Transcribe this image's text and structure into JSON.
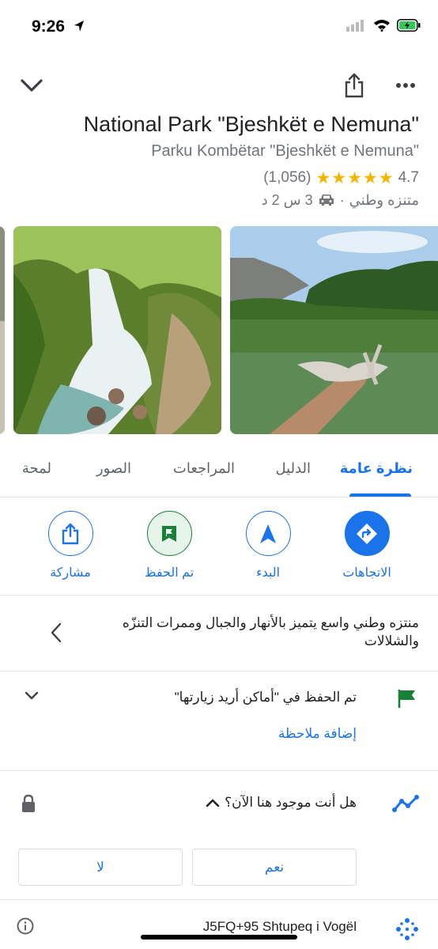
{
  "status_bar": {
    "time": "9:26"
  },
  "place": {
    "name": "National Park \"Bjeshkët e Nemuna\"",
    "native_name": "Parku Kombëtar \"Bjeshkët e Nemuna\"",
    "rating": "4.7",
    "review_count": "(1,056)",
    "category": "متنزه وطني",
    "separator": "·",
    "drive_time": "3 س 2 د"
  },
  "tabs": [
    {
      "label": "نظرة عامة",
      "active": true
    },
    {
      "label": "الدليل"
    },
    {
      "label": "المراجعات"
    },
    {
      "label": "الصور"
    },
    {
      "label": "لمحة"
    }
  ],
  "actions": {
    "directions": "الاتجاهات",
    "start": "البدء",
    "saved": "تم الحفظ",
    "share": "مشاركة"
  },
  "description": "منتزه وطني واسع يتميز بالأنهار والجبال وممرات التنزّه والشلالات",
  "saved_list": {
    "text": "تم الحفظ في \"أماكن أريد زيارتها\"",
    "add_note": "إضافة ملاحظة"
  },
  "here_question": {
    "text": "هل أنت موجود هنا الآن؟",
    "yes": "نعم",
    "no": "لا"
  },
  "plus_code": "J5FQ+95 Shtupeq i Vogël",
  "colors": {
    "accent": "#1a73e8",
    "saved_green": "#188038",
    "star": "#f4b400"
  },
  "icons": [
    "chevron-down-icon",
    "share-icon",
    "more-icon",
    "car-icon",
    "directions-icon",
    "navigation-icon",
    "bookmark-flag-icon",
    "flag-icon",
    "trend-icon",
    "lock-icon",
    "info-icon",
    "plus-code-icon"
  ]
}
